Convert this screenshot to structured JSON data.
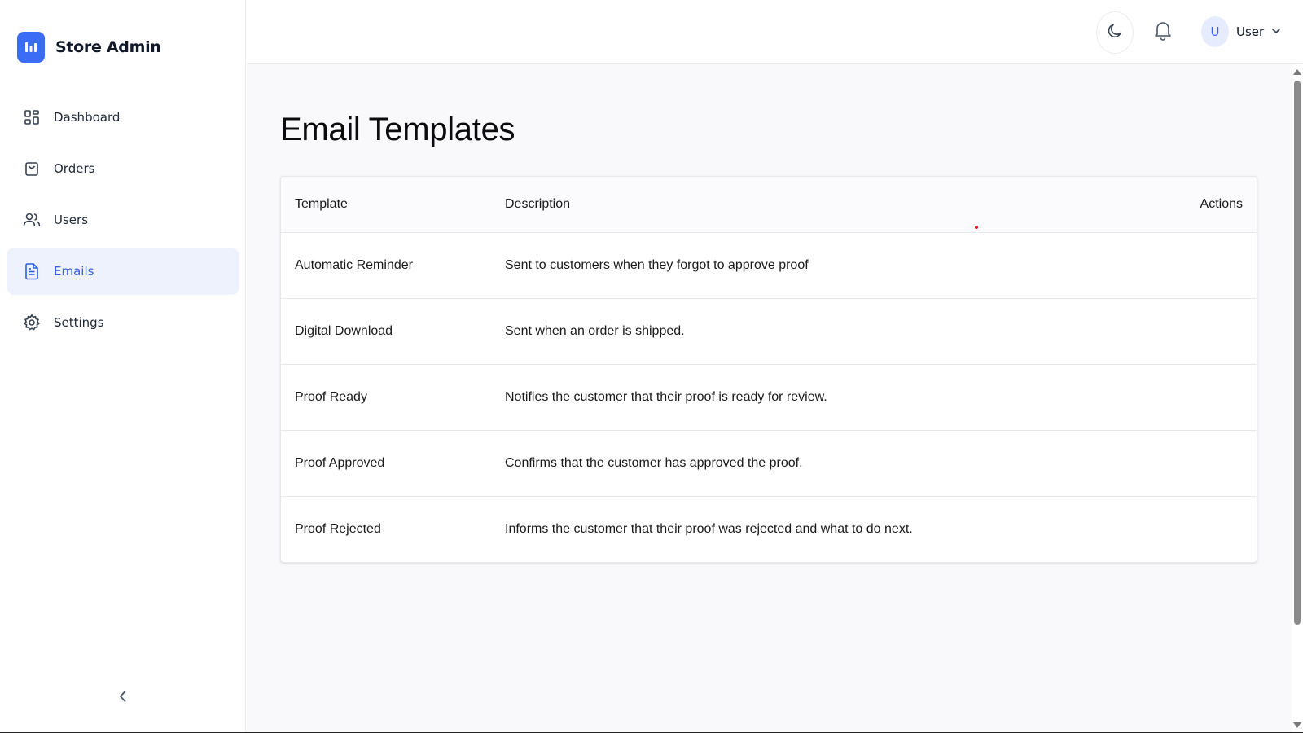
{
  "brand": {
    "name": "Store Admin",
    "logo_icon": "bar-chart-icon",
    "accent": "#3b6cf5"
  },
  "sidebar": {
    "items": [
      {
        "label": "Dashboard",
        "icon": "layout-grid-icon",
        "active": false
      },
      {
        "label": "Orders",
        "icon": "shopping-bag-icon",
        "active": false
      },
      {
        "label": "Users",
        "icon": "users-icon",
        "active": false
      },
      {
        "label": "Emails",
        "icon": "file-text-icon",
        "active": true
      },
      {
        "label": "Settings",
        "icon": "gear-icon",
        "active": false
      }
    ],
    "collapse_icon": "chevron-left-icon"
  },
  "header": {
    "theme_icon": "moon-icon",
    "notifications_icon": "bell-icon",
    "user": {
      "initial": "U",
      "name": "User",
      "menu_icon": "chevron-down-icon"
    }
  },
  "main": {
    "title": "Email Templates",
    "table": {
      "columns": [
        "Template",
        "Description",
        "Actions"
      ],
      "rows": [
        {
          "template": "Automatic Reminder",
          "description": "Sent to customers when they forgot to approve proof"
        },
        {
          "template": "Digital Download",
          "description": "Sent when an order is shipped."
        },
        {
          "template": "Proof Ready",
          "description": "Notifies the customer that their proof is ready for review."
        },
        {
          "template": "Proof Approved",
          "description": "Confirms that the customer has approved the proof."
        },
        {
          "template": "Proof Rejected",
          "description": "Informs the customer that their proof was rejected and what to do next."
        }
      ]
    }
  },
  "colors": {
    "active_nav_bg": "#eef2fd",
    "active_nav_text": "#2f5ee0",
    "main_bg": "#f9f9fb"
  }
}
